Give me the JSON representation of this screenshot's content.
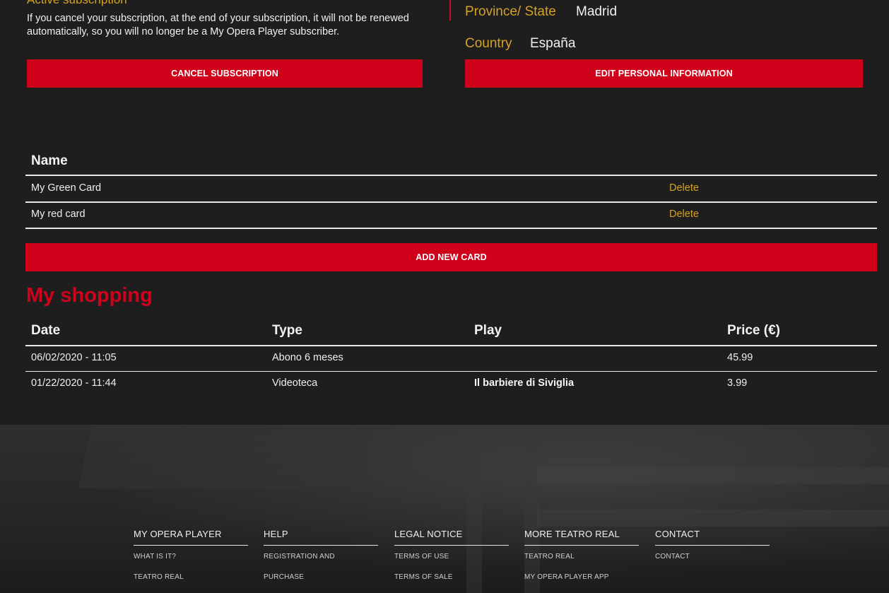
{
  "subscription": {
    "status_label": "Active subscription",
    "cancel_text": "If you cancel your subscription, at the end of your subscription, it will not be renewed automatically, so you will no longer be a My Opera Player subscriber.",
    "cancel_button": "CANCEL SUBSCRIPTION"
  },
  "personal": {
    "province_label": "Province/ State",
    "province_value": "Madrid",
    "country_label": "Country",
    "country_value": "España",
    "edit_button": "EDIT PERSONAL INFORMATION"
  },
  "cards": {
    "header": "Name",
    "rows": [
      {
        "name": "My Green Card",
        "action": "Delete"
      },
      {
        "name": "My red card",
        "action": "Delete"
      }
    ],
    "add_button": "ADD NEW CARD"
  },
  "shopping": {
    "title": "My shopping",
    "headers": {
      "date": "Date",
      "type": "Type",
      "play": "Play",
      "price": "Price (€)"
    },
    "rows": [
      {
        "date": "06/02/2020 - 11:05",
        "type": "Abono 6 meses",
        "play": "",
        "price": "45.99"
      },
      {
        "date": "01/22/2020 - 11:44",
        "type": "Videoteca",
        "play": "Il barbiere di Siviglia",
        "price": "3.99"
      }
    ]
  },
  "footer": {
    "columns": [
      {
        "title": "MY OPERA PLAYER",
        "links": [
          "WHAT IS IT?",
          "TEATRO REAL"
        ]
      },
      {
        "title": "HELP",
        "links": [
          "REGISTRATION AND",
          "PURCHASE"
        ]
      },
      {
        "title": "LEGAL NOTICE",
        "links": [
          "TERMS OF USE",
          "TERMS OF SALE"
        ]
      },
      {
        "title": "MORE TEATRO REAL",
        "links": [
          "TEATRO REAL",
          "MY OPERA PLAYER APP"
        ]
      },
      {
        "title": "CONTACT",
        "links": [
          "CONTACT"
        ]
      }
    ]
  },
  "colors": {
    "accent_red": "#d0021b",
    "gold": "#d4a224",
    "background": "#1e1e1f"
  }
}
